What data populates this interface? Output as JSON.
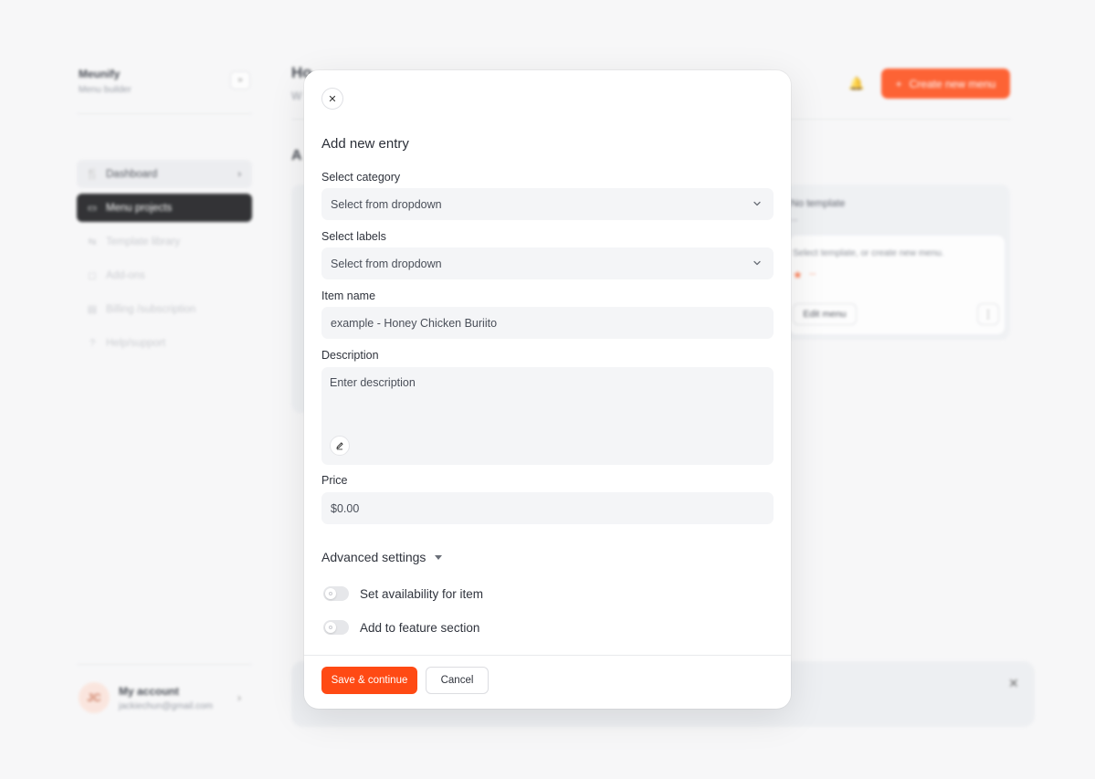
{
  "sidebar": {
    "brand_name": "Meunify",
    "brand_sub": "Menu builder",
    "items": [
      {
        "label": "Dashboard",
        "icon": "utensils-icon"
      },
      {
        "label": "Menu projects",
        "icon": "folder-icon"
      },
      {
        "label": "Template library",
        "icon": "swap-icon"
      },
      {
        "label": "Add-ons",
        "icon": "puzzle-icon"
      },
      {
        "label": "Billing /subscription",
        "icon": "card-icon"
      },
      {
        "label": "Help/support",
        "icon": "help-icon"
      }
    ],
    "account": {
      "initials": "JC",
      "name": "My account",
      "email": "jackiechun@gmail.com"
    }
  },
  "header": {
    "title": "Ho",
    "subtitle": "W",
    "create_label": "Create new menu"
  },
  "content": {
    "section_title": "A",
    "card": {
      "title": "No template",
      "dash": "--",
      "text": "Select template, or create new menu.",
      "rating_dash": "--",
      "edit_label": "Edit menu"
    }
  },
  "modal": {
    "title": "Add new entry",
    "category": {
      "label": "Select category",
      "value": "Select from dropdown"
    },
    "labels": {
      "label": "Select labels",
      "value": "Select from dropdown"
    },
    "item_name": {
      "label": "Item name",
      "placeholder": "example - Honey Chicken Buriito"
    },
    "description": {
      "label": "Description",
      "placeholder": "Enter description"
    },
    "price": {
      "label": "Price",
      "value": "$0.00"
    },
    "advanced_label": "Advanced settings",
    "toggles": [
      {
        "label": "Set availability for item",
        "on": false
      },
      {
        "label": "Add to feature section",
        "on": false
      }
    ],
    "save_label": "Save & continue",
    "cancel_label": "Cancel"
  },
  "colors": {
    "accent": "#ff4a14",
    "active_nav": "#111215",
    "field_bg": "#f4f5f7"
  }
}
